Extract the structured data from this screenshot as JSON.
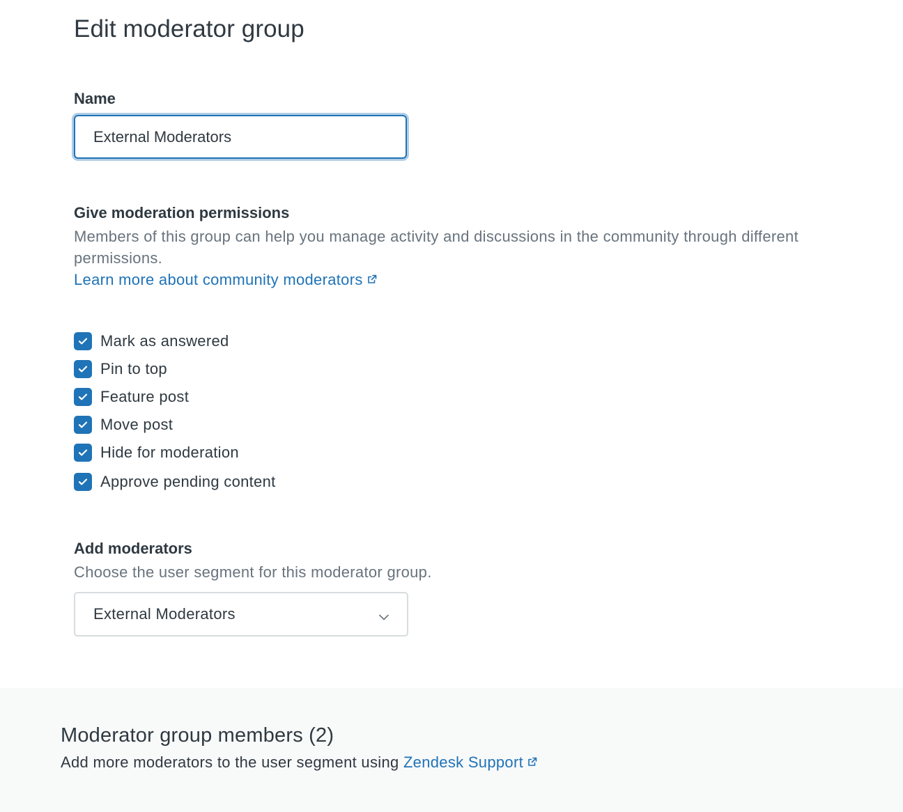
{
  "page": {
    "title": "Edit moderator group"
  },
  "name_field": {
    "label": "Name",
    "value": "External Moderators"
  },
  "permissions": {
    "label": "Give moderation permissions",
    "description": "Members of this group can help you manage activity and discussions in the community through different permissions.",
    "learn_more_link": "Learn more about community moderators",
    "items": [
      {
        "label": "Mark as answered",
        "checked": true
      },
      {
        "label": "Pin to top",
        "checked": true
      },
      {
        "label": "Feature post",
        "checked": true
      },
      {
        "label": "Move post",
        "checked": true
      },
      {
        "label": "Hide for moderation",
        "checked": true
      },
      {
        "label": "Approve pending content",
        "checked": true
      }
    ]
  },
  "moderators": {
    "label": "Add moderators",
    "description": "Choose the user segment for this moderator group.",
    "selected_segment": "External Moderators"
  },
  "members": {
    "title": "Moderator group members (2)",
    "hint_prefix": "Add more moderators to the user segment using ",
    "hint_link": "Zendesk Support"
  },
  "icons": {
    "external_link": "external-link-icon",
    "checkmark": "checkmark-icon",
    "chevron": "chevron-down-icon"
  },
  "colors": {
    "accent": "#1f73b7",
    "text": "#2f3941",
    "muted": "#68737d",
    "footer_bg": "#f8f9f9"
  }
}
